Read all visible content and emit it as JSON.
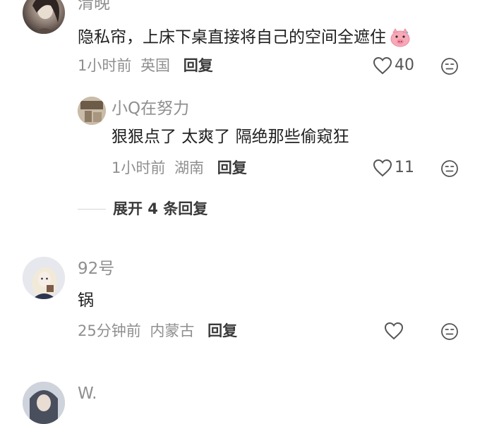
{
  "comments": [
    {
      "username": "清晚",
      "text": "隐私帘，上床下桌直接将自己的空间全遮住",
      "time": "1小时前",
      "location": "英国",
      "reply_label": "回复",
      "likes": "40"
    },
    {
      "username": "小Q在努力",
      "text": "狠狠点了 太爽了 隔绝那些偷窥狂",
      "time": "1小时前",
      "location": "湖南",
      "reply_label": "回复",
      "likes": "11"
    },
    {
      "username": "92号",
      "text": "锅",
      "time": "25分钟前",
      "location": "内蒙古",
      "reply_label": "回复",
      "likes": ""
    },
    {
      "username": "W."
    }
  ],
  "expand_replies_label": "展开 4 条回复",
  "emoji": "pig-face-emoji",
  "colors": {
    "meta_gray": "#8f8f8f",
    "text_dark": "#1f1f1f",
    "emoji_pink": "#f7a9b8"
  }
}
